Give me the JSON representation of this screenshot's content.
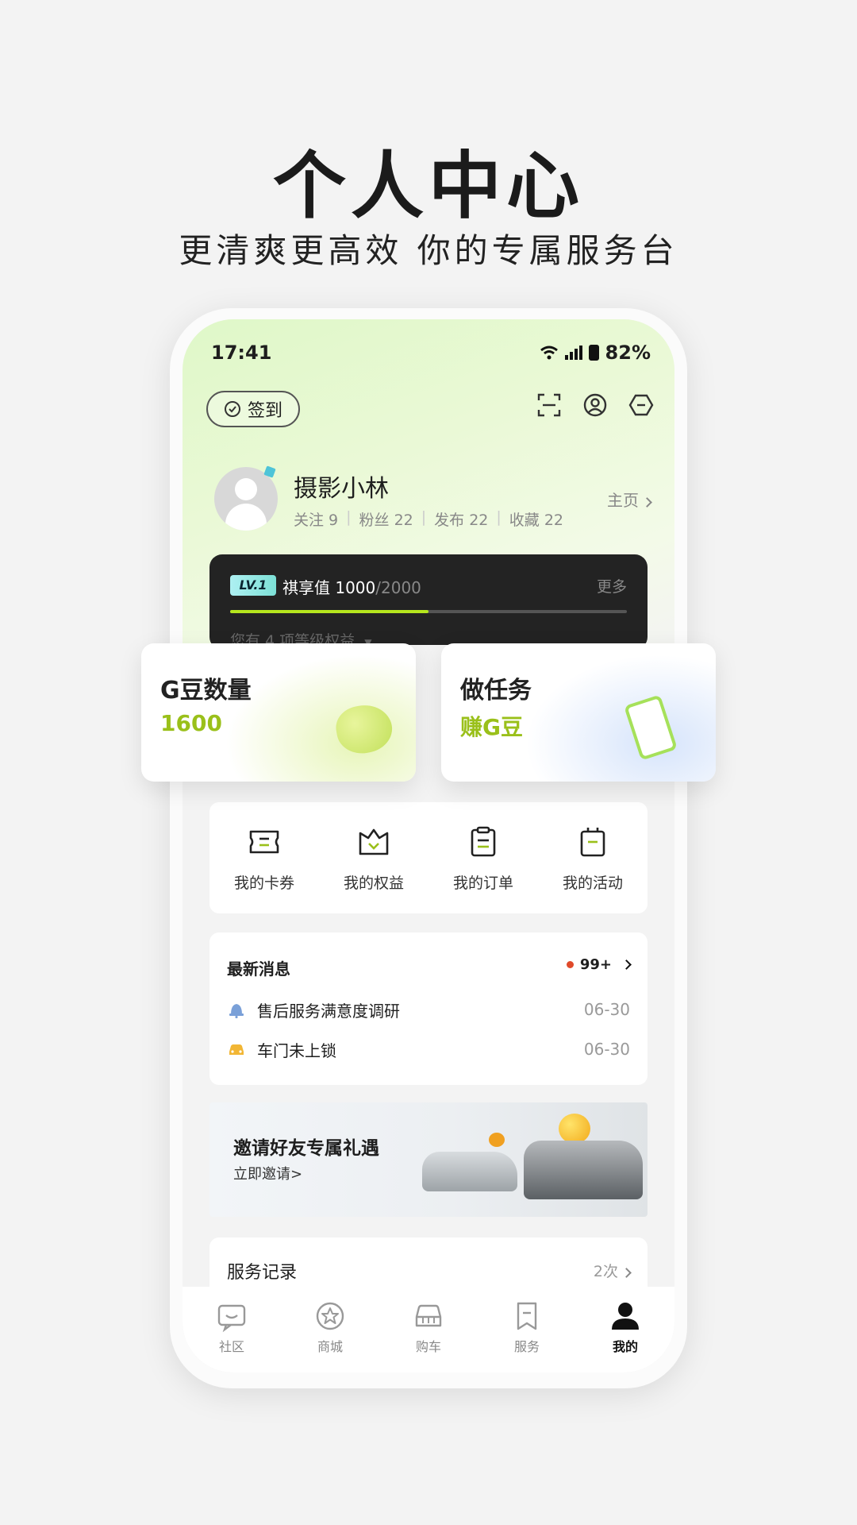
{
  "hero": {
    "title": "个人中心",
    "subtitle": "更清爽更高效  你的专属服务台"
  },
  "status_bar": {
    "time": "17:41",
    "battery": "82%"
  },
  "header": {
    "checkin_label": "签到",
    "icons": [
      "scan-icon",
      "user-icon",
      "settings-icon"
    ]
  },
  "profile": {
    "nickname": "摄影小林",
    "stats": [
      {
        "label": "关注 9"
      },
      {
        "label": "粉丝 22"
      },
      {
        "label": "发布 22"
      },
      {
        "label": "收藏 22"
      }
    ],
    "homepage_label": "主页"
  },
  "level": {
    "badge": "LV.1",
    "label": "祺享值",
    "value": "1000",
    "max": "/2000",
    "progress": 0.5,
    "more_label": "更多",
    "benefits_text": "您有 4 项等级权益"
  },
  "cards": {
    "beans_title": "G豆数量",
    "beans_value": "1600",
    "task_title": "做任务",
    "task_sub": "赚G豆"
  },
  "grid": [
    {
      "label": "我的卡券",
      "icon": "coupon-icon"
    },
    {
      "label": "我的权益",
      "icon": "benefits-icon"
    },
    {
      "label": "我的订单",
      "icon": "order-icon"
    },
    {
      "label": "我的活动",
      "icon": "activity-icon"
    }
  ],
  "messages": {
    "title": "最新消息",
    "count": "99+",
    "items": [
      {
        "text": "售后服务满意度调研",
        "date": "06-30",
        "icon": "bell-icon"
      },
      {
        "text": "车门未上锁",
        "date": "06-30",
        "icon": "car-icon"
      }
    ]
  },
  "banner": {
    "title": "邀请好友专属礼遇",
    "link": "立即邀请>"
  },
  "service": {
    "title": "服务记录",
    "count": "2次"
  },
  "tabs": [
    {
      "label": "社区",
      "icon": "community-icon"
    },
    {
      "label": "商城",
      "icon": "mall-icon"
    },
    {
      "label": "购车",
      "icon": "car-buy-icon"
    },
    {
      "label": "服务",
      "icon": "service-icon"
    },
    {
      "label": "我的",
      "icon": "profile-icon",
      "active": true
    }
  ],
  "colors": {
    "accent_green": "#9ac01a",
    "progress_green": "#b5e61d",
    "badge_red": "#e04a2a",
    "level_card": "#232323"
  }
}
